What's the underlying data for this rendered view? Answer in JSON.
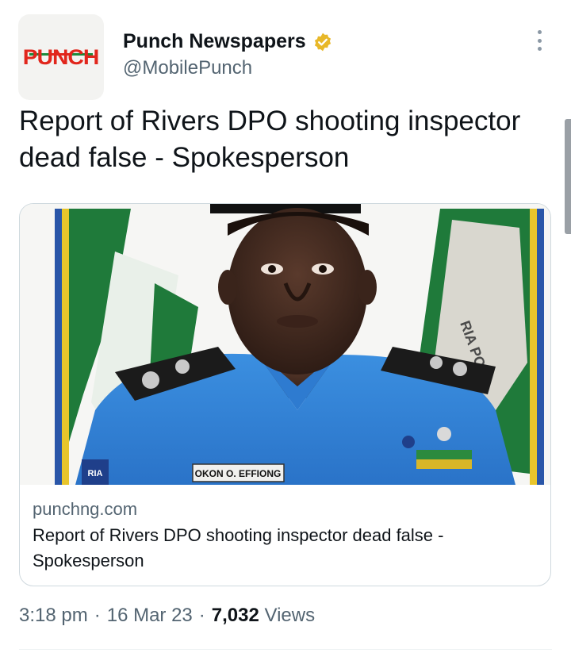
{
  "account": {
    "display_name": "Punch Newspapers",
    "handle": "@MobilePunch",
    "avatar_text": "PUNCH",
    "verified_icon": "gold-verified-badge",
    "brand_color": "#e1261c"
  },
  "tweet": {
    "text": "Report of Rivers DPO shooting inspector dead false - Spokesperson"
  },
  "link_card": {
    "domain": "punchng.com",
    "title": "Report of Rivers DPO shooting inspector dead false - Spokesperson",
    "image": {
      "nameplate": "OKON O. EFFIONG",
      "badge_text": "RIA PO",
      "flag_text": "RIA\nCE"
    }
  },
  "meta": {
    "time": "3:18 pm",
    "separator": "·",
    "date": "16 Mar 23",
    "views_count": "7,032",
    "views_label": "Views"
  },
  "icons": {
    "more": "more-vertical-icon"
  }
}
